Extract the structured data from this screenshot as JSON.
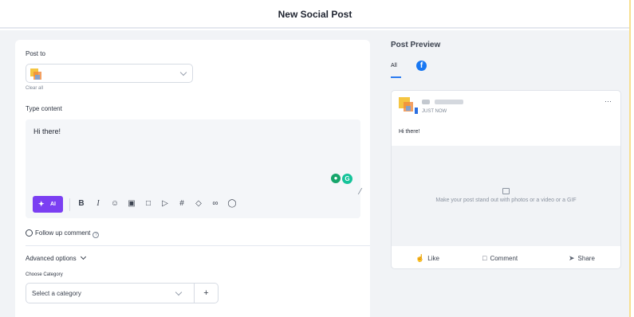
{
  "header": {
    "title": "New Social Post"
  },
  "composer": {
    "post_to_label": "Post to",
    "clear_all": "Clear all",
    "type_content_label": "Type content",
    "content_text": "Hi there!",
    "ai_button_label": "AI",
    "toolbar_icons": [
      "bold-icon",
      "italic-icon",
      "emoji-icon",
      "image-icon",
      "file-icon",
      "video-icon",
      "hashtag-icon",
      "tag-icon",
      "link-icon",
      "mention-icon"
    ],
    "follow_up_label": "Follow up comment",
    "advanced_options_label": "Advanced options",
    "choose_category_label": "Choose Category",
    "category_placeholder": "Select a category",
    "add_category_label": "+"
  },
  "preview": {
    "title": "Post Preview",
    "tabs": [
      {
        "label": "All",
        "active": true
      },
      {
        "label": "",
        "icon": "facebook-icon",
        "active": false
      }
    ],
    "card": {
      "timestamp": "JUST NOW",
      "post_text": "Hi there!",
      "media_hint": "Make your post stand out with photos or a video or a GIF",
      "actions": {
        "like": "Like",
        "comment": "Comment",
        "share": "Share"
      }
    }
  },
  "colors": {
    "accent": "#2b7bf0",
    "ai_button": "#7b3ff2",
    "facebook": "#1877f2",
    "grammarly": "#15c39a"
  }
}
